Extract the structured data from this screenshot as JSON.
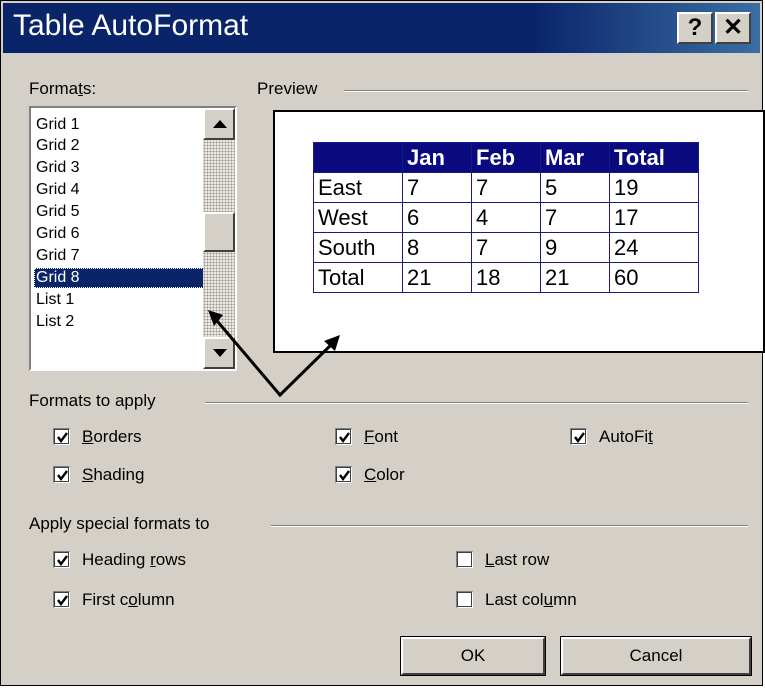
{
  "window": {
    "title": "Table AutoFormat"
  },
  "title_buttons": {
    "help": "?",
    "close": "✕"
  },
  "formats": {
    "label_before": "Forma",
    "label_key": "t",
    "label_after": "s:",
    "items": [
      "Grid 1",
      "Grid 2",
      "Grid 3",
      "Grid 4",
      "Grid 5",
      "Grid 6",
      "Grid 7",
      "Grid 8",
      "List 1",
      "List 2"
    ],
    "selected": "Grid 8"
  },
  "preview": {
    "label": "Preview",
    "header": [
      "",
      "Jan",
      "Feb",
      "Mar",
      "Total"
    ],
    "rows": [
      [
        "East",
        "7",
        "7",
        "5",
        "19"
      ],
      [
        "West",
        "6",
        "4",
        "7",
        "17"
      ],
      [
        "South",
        "8",
        "7",
        "9",
        "24"
      ],
      [
        "Total",
        "21",
        "18",
        "21",
        "60"
      ]
    ]
  },
  "formats_to_apply": {
    "label": "Formats to apply",
    "borders": {
      "key": "B",
      "rest": "orders",
      "checked": true
    },
    "font": {
      "key": "F",
      "rest": "ont",
      "checked": true
    },
    "autofit": {
      "before": "AutoFi",
      "key": "t",
      "after": "",
      "checked": true
    },
    "shading": {
      "key": "S",
      "rest": "hading",
      "checked": true
    },
    "color": {
      "key": "C",
      "rest": "olor",
      "checked": true
    }
  },
  "special_formats": {
    "label": "Apply special formats to",
    "heading_rows": {
      "before": "Heading ",
      "key": "r",
      "after": "ows",
      "checked": true
    },
    "last_row": {
      "before": "",
      "key": "L",
      "after": "ast row",
      "checked": false
    },
    "first_column": {
      "before": "First c",
      "key": "o",
      "after": "lumn",
      "checked": true
    },
    "last_column": {
      "before": "Last col",
      "key": "u",
      "after": "mn",
      "checked": false
    }
  },
  "buttons": {
    "ok": "OK",
    "cancel": "Cancel"
  }
}
